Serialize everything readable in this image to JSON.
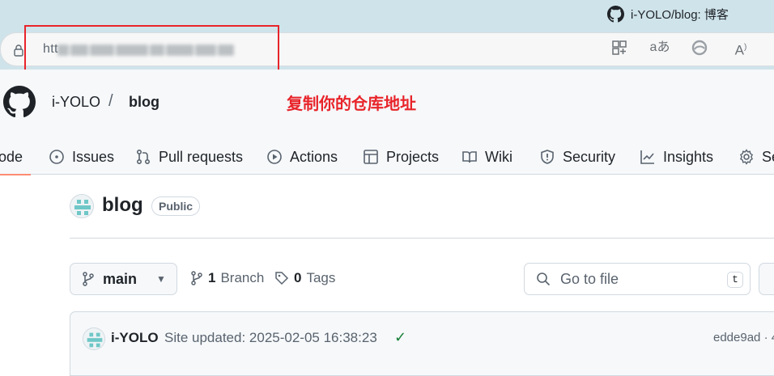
{
  "browser": {
    "tab_title": "i-YOLO/blog: 博客",
    "url_prefix": "htt",
    "url_blurred": true,
    "icons": [
      "split-screen-icon",
      "translate-icon",
      "edge-icon",
      "read-aloud-icon"
    ]
  },
  "annotation": {
    "text": "复制你的仓库地址",
    "color": "#e8242a"
  },
  "header": {
    "owner": "i-YOLO",
    "separator": "/",
    "repo": "blog"
  },
  "nav_tabs": [
    {
      "label": "ode",
      "icon": "code-icon",
      "active": true
    },
    {
      "label": "Issues",
      "icon": "issue-icon"
    },
    {
      "label": "Pull requests",
      "icon": "pull-request-icon"
    },
    {
      "label": "Actions",
      "icon": "play-icon"
    },
    {
      "label": "Projects",
      "icon": "table-icon"
    },
    {
      "label": "Wiki",
      "icon": "book-icon"
    },
    {
      "label": "Security",
      "icon": "shield-icon"
    },
    {
      "label": "Insights",
      "icon": "graph-icon"
    },
    {
      "label": "Se",
      "icon": "gear-icon"
    }
  ],
  "repo": {
    "name": "blog",
    "visibility": "Public"
  },
  "toolbar": {
    "branch": "main",
    "branch_count": "1",
    "branch_label": "Branch",
    "tag_count": "0",
    "tag_label": "Tags",
    "goto_placeholder": "Go to file",
    "goto_shortcut": "t"
  },
  "commit": {
    "author": "i-YOLO",
    "message": "Site updated: 2025-02-05 16:38:23",
    "sha": "edde9ad · 4"
  }
}
